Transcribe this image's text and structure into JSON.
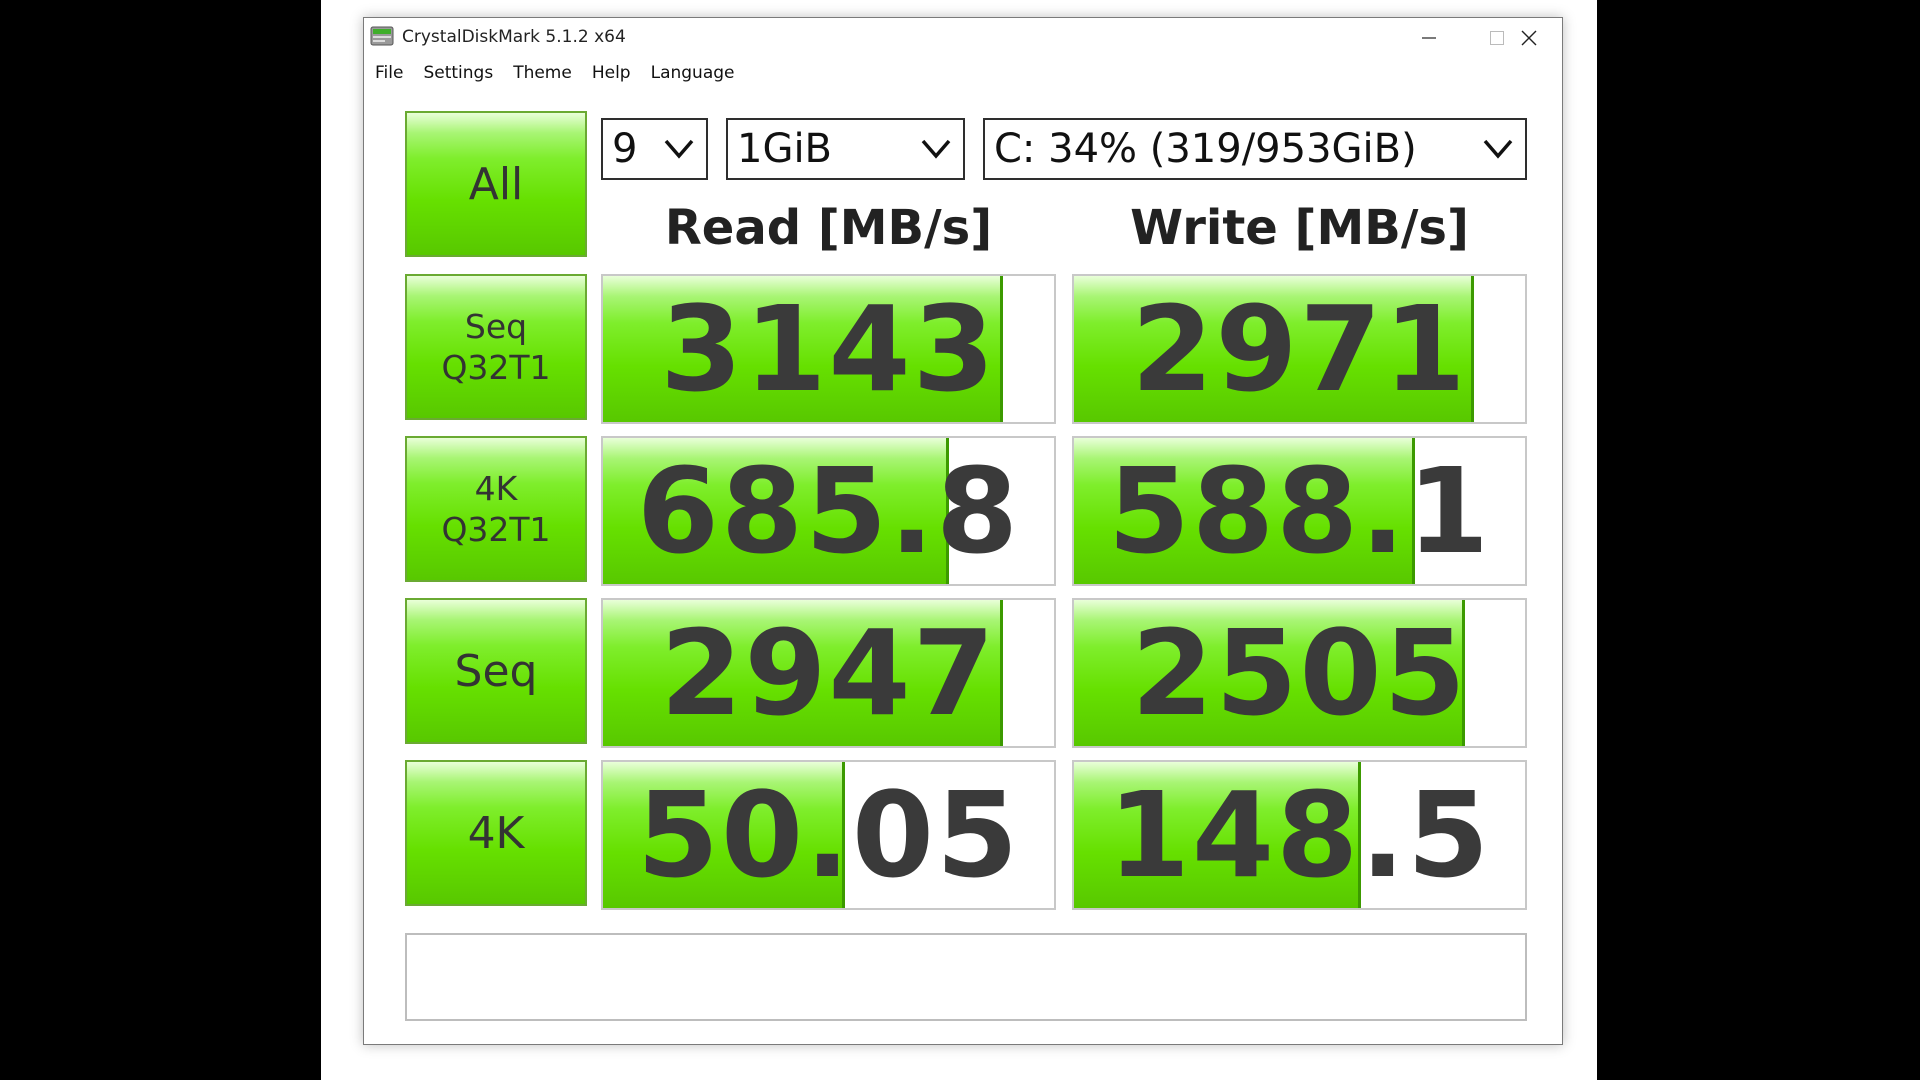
{
  "window": {
    "title": "CrystalDiskMark 5.1.2 x64"
  },
  "menu": [
    "File",
    "Settings",
    "Theme",
    "Help",
    "Language"
  ],
  "controls": {
    "all_label": "All",
    "count": "9",
    "size": "1GiB",
    "drive": "C: 34% (319/953GiB)"
  },
  "headers": {
    "read": "Read [MB/s]",
    "write": "Write [MB/s]"
  },
  "rows": [
    {
      "label": "Seq\nQ32T1",
      "read": "3143",
      "write": "2971",
      "read_fill": 0.88,
      "write_fill": 0.88
    },
    {
      "label": "4K\nQ32T1",
      "read": "685.8",
      "write": "588.1",
      "read_fill": 0.76,
      "write_fill": 0.75
    },
    {
      "label": "Seq",
      "read": "2947",
      "write": "2505",
      "read_fill": 0.88,
      "write_fill": 0.86
    },
    {
      "label": "4K",
      "read": "50.05",
      "write": "148.5",
      "read_fill": 0.53,
      "write_fill": 0.63
    }
  ],
  "comment": "",
  "colors": {
    "green_top": "#a8f574",
    "green_mid": "#66e000",
    "green_edge": "#3c9a00",
    "text": "#3a3a3a"
  }
}
